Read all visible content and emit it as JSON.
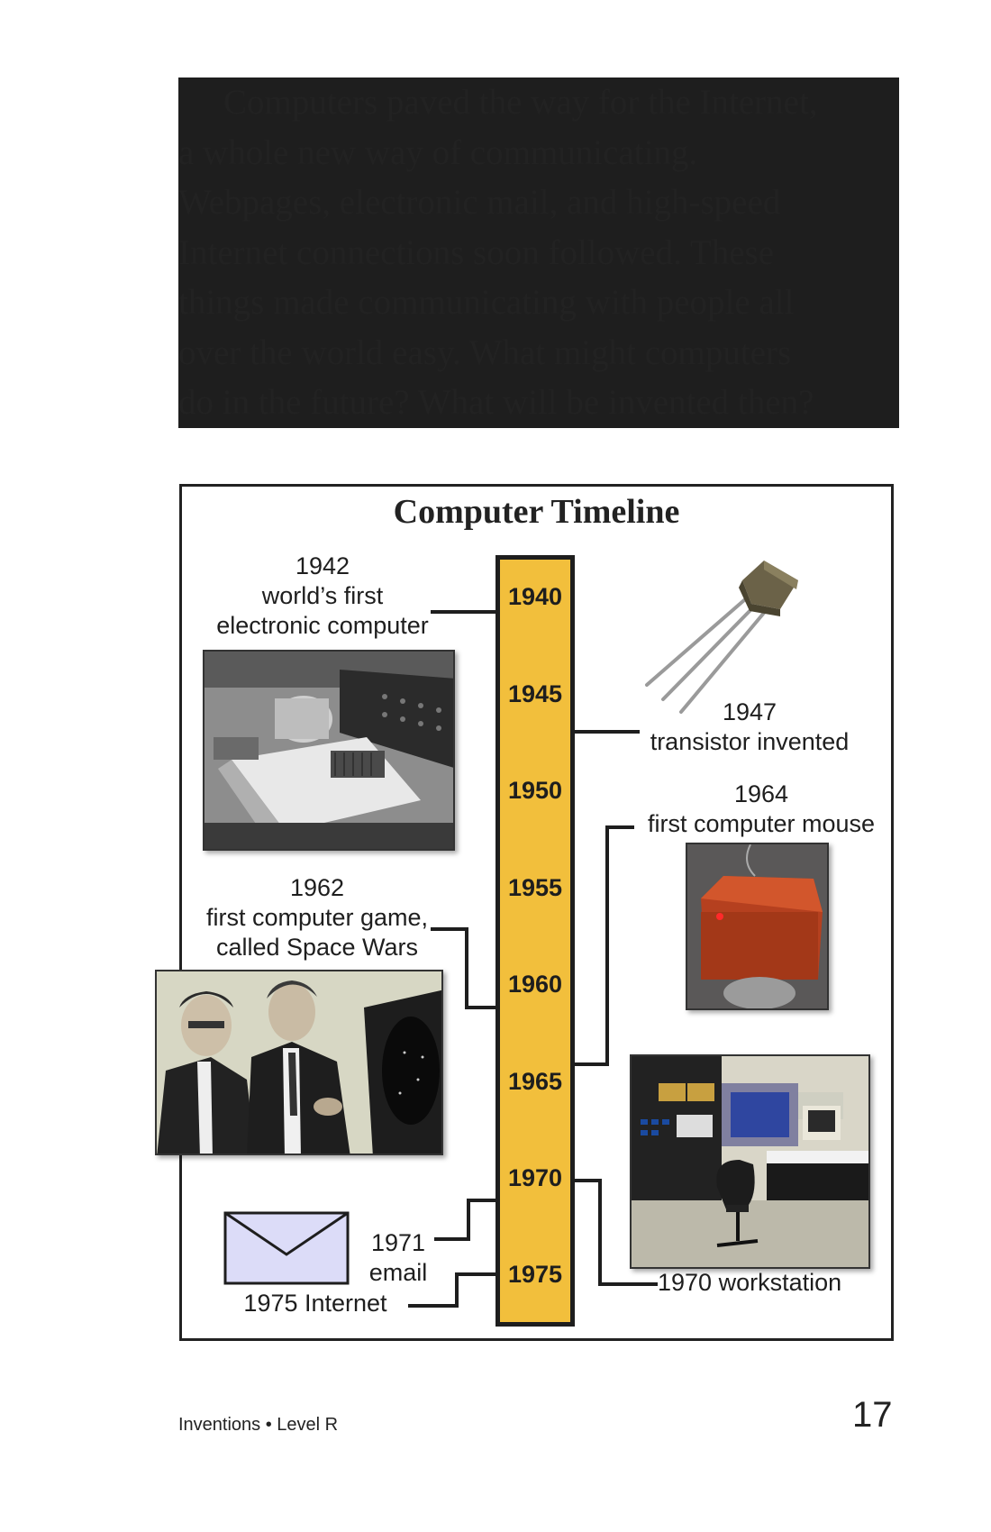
{
  "paragraph": {
    "lines": [
      "Computers paved the way for the Internet,",
      "a whole new way of communicating.",
      "Webpages, electronic mail, and high-speed",
      "Internet connections soon followed. These",
      "things made communicating with people all",
      "over the world easy. What might computers",
      "do in the future? What will be invented then?"
    ]
  },
  "timeline": {
    "title": "Computer Timeline",
    "years": [
      "1940",
      "1945",
      "1950",
      "1955",
      "1960",
      "1965",
      "1970",
      "1975"
    ],
    "events": {
      "e1942": [
        "1942",
        "world’s first",
        "electronic computer"
      ],
      "e1947": [
        "1947",
        "transistor invented"
      ],
      "e1964": [
        "1964",
        "first computer mouse"
      ],
      "e1962": [
        "1962",
        "first computer game,",
        "called Space Wars"
      ],
      "e1971": [
        "1971",
        "email"
      ],
      "e1975": "1975 Internet",
      "e1970": "1970 workstation"
    }
  },
  "footer": {
    "book": "Inventions • Level R",
    "page": "17"
  },
  "colors": {
    "bar": "#f2bf3c",
    "envelope": "#dcdcf8"
  }
}
